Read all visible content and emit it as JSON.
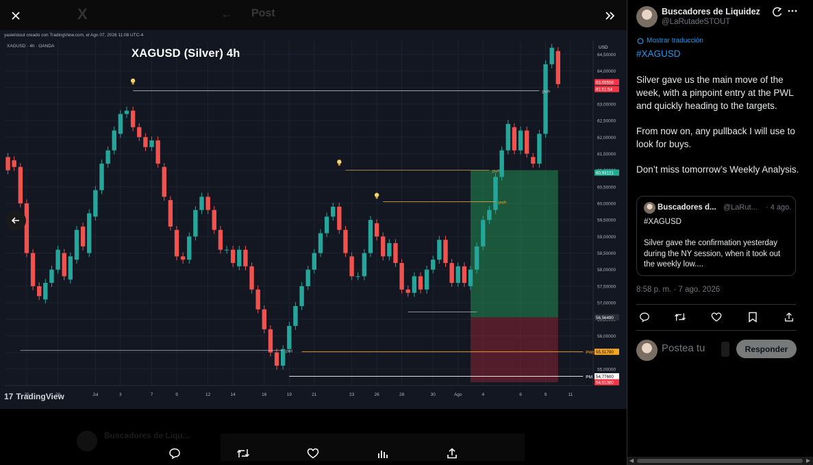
{
  "background": {
    "x_logo": "X",
    "post_title": "Post",
    "ghost_author": "Buscadores de Liqu..."
  },
  "chart": {
    "author_line": "yaslelstout creado con TradingView.com, el Ago 07, 2026 11:08 UTC-4",
    "symbol_line": "XAGUSD · 4h · OANDA",
    "title": "XAGUSD (Silver) 4h",
    "currency": "USD",
    "tradingview_logo": "TradingView"
  },
  "chart_data": {
    "type": "candlestick",
    "title": "XAGUSD (Silver) 4h",
    "currency": "USD",
    "y_ticks": [
      "64,50000",
      "64,00000",
      "63,50000",
      "63,00000",
      "62,50000",
      "62,00000",
      "61,50000",
      "61,00000",
      "60,50000",
      "60,00000",
      "59,50000",
      "59,00000",
      "58,50000",
      "58,00000",
      "57,50000",
      "57,00000",
      "56,50000",
      "56,00000",
      "55,50000",
      "55,00000"
    ],
    "y_ticks_values": [
      64.5,
      64.0,
      63.5,
      63.0,
      62.5,
      62.0,
      61.5,
      61.0,
      60.5,
      60.0,
      59.5,
      59.0,
      58.5,
      58.0,
      57.5,
      57.0,
      56.5,
      56.0,
      55.5,
      55.0
    ],
    "ylim": [
      54.5,
      64.9
    ],
    "x_ticks": [
      "25",
      "28",
      "Jul",
      "3",
      "7",
      "9",
      "12",
      "14",
      "16",
      "19",
      "21",
      "23",
      "26",
      "28",
      "30",
      "Ago",
      "4",
      "6",
      "9",
      "11"
    ],
    "x_tick_slot": [
      3,
      8,
      14,
      18,
      23,
      27,
      32,
      36,
      41,
      45,
      49,
      55,
      59,
      63,
      68,
      72,
      76,
      82,
      86,
      90
    ],
    "slot_count": 94,
    "price_labels": [
      {
        "text": "63,65558",
        "value": 63.66,
        "color": "#f23645"
      },
      {
        "text": "81:51:54",
        "value": 63.45,
        "color": "#f23645"
      },
      {
        "text": "60,93121",
        "value": 60.93,
        "color": "#22ab94"
      },
      {
        "text": "56,56490",
        "value": 56.56,
        "color": "#2a2e39"
      },
      {
        "text": "55,51790",
        "value": 55.52,
        "color": "#f5a623"
      },
      {
        "text": "54,77600",
        "value": 54.78,
        "color": "#ffffff"
      },
      {
        "text": "54,61380",
        "value": 54.6,
        "color": "#f23645"
      }
    ],
    "levels": [
      {
        "name": "pwh",
        "label": "pwh",
        "value": 63.4,
        "slot_from": 20,
        "slot_to": 85,
        "color": "#b2b5be"
      },
      {
        "name": "pwh",
        "label": "pwh",
        "value": 61.0,
        "slot_from": 54,
        "slot_to": 77,
        "color": "#d4a34a"
      },
      {
        "name": "pwh",
        "label": "pwh",
        "value": 60.05,
        "slot_from": 60,
        "slot_to": 78,
        "color": "#d4a34a"
      },
      {
        "name": "pwl",
        "label": "pwl",
        "value": 55.56,
        "slot_from": 2,
        "slot_to": 44,
        "color": "#b2b5be"
      },
      {
        "name": "PWL",
        "label": "PWL",
        "value": 55.52,
        "slot_from": 47,
        "slot_to": 92,
        "color": "#f5a623"
      },
      {
        "name": "PML",
        "label": "PML",
        "value": 54.78,
        "slot_from": 45,
        "slot_to": 92,
        "color": "#ffffff"
      },
      {
        "name": "range-low",
        "label": "",
        "value": 56.72,
        "slot_from": 64,
        "slot_to": 75,
        "color": "#b2b5be"
      }
    ],
    "position": {
      "slot_from": 74,
      "slot_to": 88,
      "entry": 56.56,
      "target": 61.0,
      "stop": 54.6
    },
    "alerts": [
      {
        "slot": 20,
        "value": 63.6
      },
      {
        "slot": 53,
        "value": 61.15
      },
      {
        "slot": 59,
        "value": 60.15
      }
    ],
    "candles": [
      [
        61.4,
        61.0
      ],
      [
        61.3,
        61.1
      ],
      [
        61.1,
        60.0
      ],
      [
        60.0,
        58.5
      ],
      [
        58.5,
        57.5
      ],
      [
        57.5,
        57.2
      ],
      [
        57.1,
        57.6
      ],
      [
        57.6,
        58.0
      ],
      [
        58.0,
        58.6
      ],
      [
        58.5,
        57.8
      ],
      [
        57.7,
        58.4
      ],
      [
        58.3,
        59.2
      ],
      [
        59.3,
        58.7
      ],
      [
        58.5,
        59.7
      ],
      [
        59.6,
        60.4
      ],
      [
        60.4,
        61.2
      ],
      [
        61.2,
        61.6
      ],
      [
        61.6,
        62.2
      ],
      [
        62.1,
        62.7
      ],
      [
        62.7,
        62.8
      ],
      [
        62.8,
        62.3
      ],
      [
        62.3,
        62.0
      ],
      [
        62.0,
        61.7
      ],
      [
        61.7,
        61.9
      ],
      [
        61.9,
        61.2
      ],
      [
        61.1,
        60.2
      ],
      [
        60.1,
        59.3
      ],
      [
        59.2,
        58.4
      ],
      [
        58.4,
        58.3
      ],
      [
        58.3,
        59.0
      ],
      [
        59.0,
        59.8
      ],
      [
        59.8,
        60.2
      ],
      [
        60.2,
        59.8
      ],
      [
        59.8,
        59.2
      ],
      [
        59.2,
        58.6
      ],
      [
        58.6,
        58.6
      ],
      [
        58.6,
        58.2
      ],
      [
        58.1,
        58.6
      ],
      [
        58.6,
        58.1
      ],
      [
        58.1,
        57.4
      ],
      [
        57.4,
        56.8
      ],
      [
        56.8,
        56.2
      ],
      [
        56.2,
        55.5
      ],
      [
        55.5,
        55.1
      ],
      [
        55.1,
        55.6
      ],
      [
        55.6,
        56.3
      ],
      [
        56.3,
        56.9
      ],
      [
        56.9,
        57.5
      ],
      [
        57.5,
        58.0
      ],
      [
        58.0,
        58.5
      ],
      [
        58.5,
        59.1
      ],
      [
        59.1,
        59.6
      ],
      [
        59.6,
        59.9
      ],
      [
        59.9,
        59.2
      ],
      [
        59.2,
        58.5
      ],
      [
        58.4,
        57.8
      ],
      [
        57.8,
        57.8
      ],
      [
        57.8,
        58.5
      ],
      [
        58.5,
        59.5
      ],
      [
        59.4,
        59.0
      ],
      [
        59.0,
        58.4
      ],
      [
        58.4,
        58.8
      ],
      [
        58.8,
        58.2
      ],
      [
        58.2,
        57.4
      ],
      [
        57.4,
        57.3
      ],
      [
        57.3,
        57.8
      ],
      [
        57.8,
        57.4
      ],
      [
        57.4,
        58.0
      ],
      [
        58.0,
        58.3
      ],
      [
        58.3,
        58.9
      ],
      [
        58.9,
        58.2
      ],
      [
        58.2,
        57.6
      ],
      [
        57.6,
        58.1
      ],
      [
        58.1,
        57.6
      ],
      [
        57.5,
        58.0
      ],
      [
        58.0,
        58.7
      ],
      [
        58.7,
        59.5
      ],
      [
        59.5,
        59.8
      ],
      [
        59.8,
        60.8
      ],
      [
        60.8,
        61.6
      ],
      [
        61.6,
        62.4
      ],
      [
        62.3,
        61.6
      ],
      [
        61.6,
        62.2
      ],
      [
        62.2,
        61.5
      ],
      [
        61.4,
        61.2
      ],
      [
        61.2,
        62.1
      ],
      [
        62.1,
        64.2
      ],
      [
        64.2,
        64.7
      ],
      [
        64.6,
        63.6
      ]
    ]
  },
  "tweet": {
    "author_name": "Buscadores de Liquidez",
    "author_handle": "@LaRutadeSTOUT",
    "translate": "Mostrar traducción",
    "hashtag": "#XAGUSD",
    "para1": "Silver gave us the main move of the week, with a pinpoint entry at the PWL and quickly heading to the targets.",
    "para2": "From now on, any pullback I will use to look for buys.",
    "para3": "Don’t miss tomorrow’s Weekly Analysis.",
    "quote": {
      "name": "Buscadores d...",
      "handle": "@LaRut...",
      "date": "· 4 ago.",
      "hashtag": "#XAGUSD",
      "body": "Silver gave the confirmation yesterday during the NY session, when it took out the weekly low...."
    },
    "timestamp": "8:58 p. m. · 7 ago. 2026",
    "reply_placeholder": "Postea tu",
    "reply_button": "Responder"
  },
  "colors": {
    "accent": "#1d9bf0",
    "bull": "#26a69a",
    "bear": "#ef5350"
  }
}
